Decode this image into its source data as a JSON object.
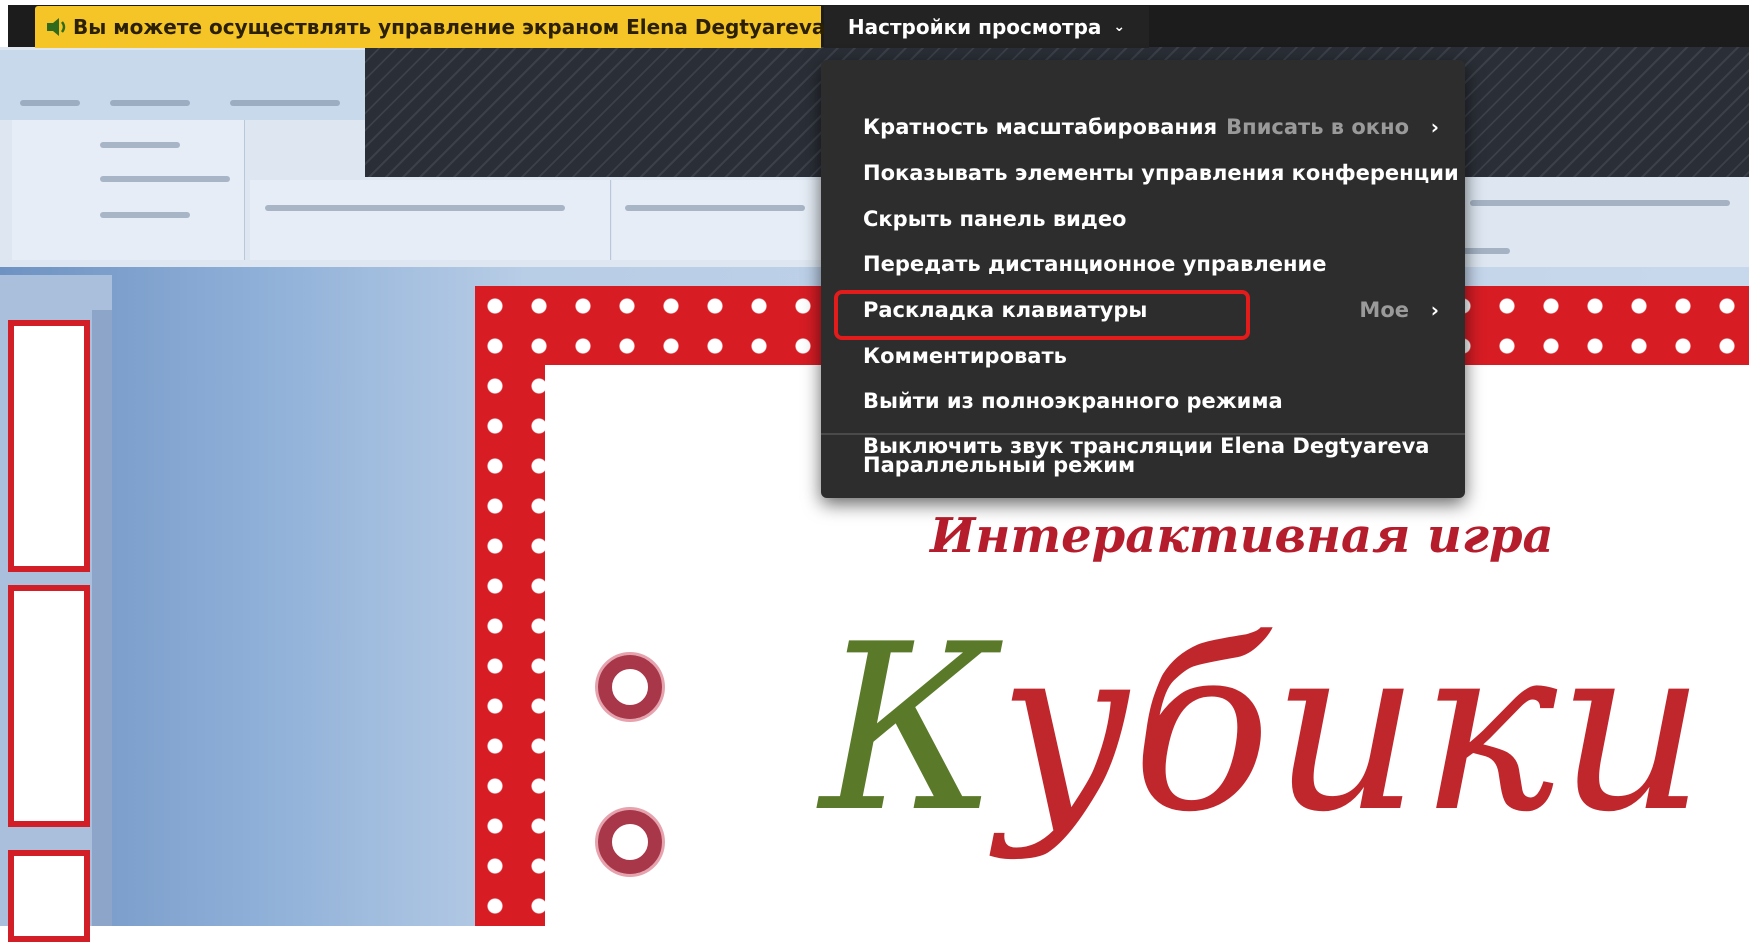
{
  "share_bar": {
    "notice_text": "Вы можете осуществлять управление экраном Elena Degtyareva",
    "view_settings_label": "Настройки просмотра",
    "speaker_icon": "speaker-icon",
    "chevron_icon": "chevron-down-icon"
  },
  "menu": {
    "items": [
      {
        "label": "Кратность масштабирования",
        "value": "Вписать в окно"
      },
      {
        "label": "Показывать элементы управления конференции"
      },
      {
        "label": "Скрыть панель видео"
      },
      {
        "label": "Передать дистанционное управление"
      },
      {
        "label": "Раскладка клавиатуры",
        "value": "Мое"
      },
      {
        "label": "Комментировать"
      },
      {
        "label": "Выйти из полноэкранного режима"
      },
      {
        "label": "Выключить звук трансляции Elena Degtyareva"
      },
      {
        "label": "Параллельный режим"
      }
    ]
  },
  "slide": {
    "title": "Интерактивная игра",
    "word_first": "К",
    "word_rest": "убики"
  },
  "colors": {
    "notice_bg": "#f5c528",
    "menu_bg": "#2d2d2d",
    "highlight": "#e21b1b",
    "slide_red": "#d71c24",
    "word_green": "#5a7a2a"
  }
}
